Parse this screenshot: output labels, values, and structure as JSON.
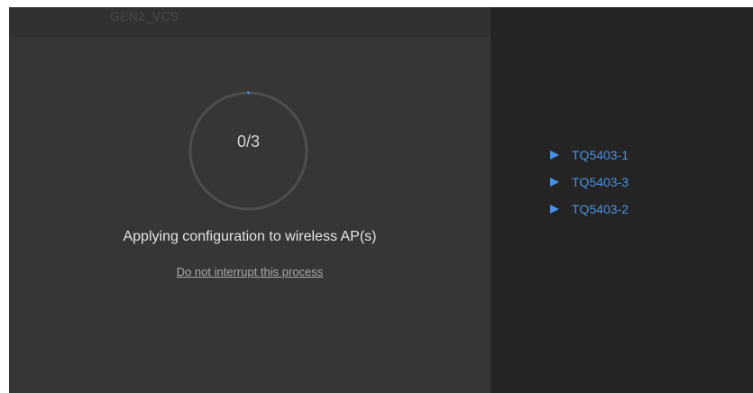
{
  "header": {
    "network_name": "GEN2_VCS"
  },
  "progress": {
    "label": "0/3",
    "completed": 0,
    "total": 3
  },
  "status": {
    "message": "Applying configuration to wireless AP(s)",
    "warning": "Do not interrupt this process"
  },
  "access_points": [
    {
      "label": "TQ5403-1",
      "icon": "play-triangle-icon"
    },
    {
      "label": "TQ5403-3",
      "icon": "play-triangle-icon"
    },
    {
      "label": "TQ5403-2",
      "icon": "play-triangle-icon"
    }
  ],
  "colors": {
    "left_background": "#363636",
    "right_background": "#242424",
    "accent": "#4a90e2",
    "ring": "#4e4e4e"
  }
}
